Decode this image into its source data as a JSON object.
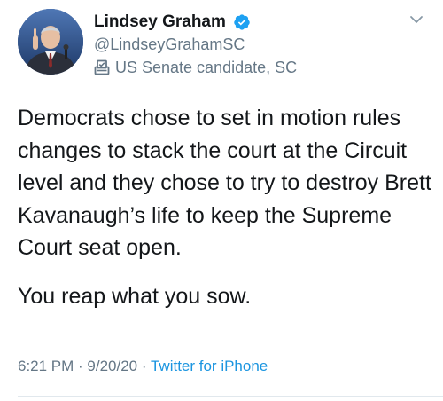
{
  "author": {
    "display_name": "Lindsey Graham",
    "handle": "@LindseyGrahamSC",
    "label": "US Senate candidate, SC",
    "verified": true
  },
  "icons": {
    "verified": "verified-badge-icon",
    "label": "ballot-box-icon",
    "menu": "chevron-down-icon"
  },
  "tweet": {
    "paragraph_1": "Democrats chose to set in motion rules changes to stack the court at the Circuit level and they chose to try to destroy Brett Kavanaugh’s life to keep the Supreme Court seat open.",
    "paragraph_2": "You reap what you sow."
  },
  "meta": {
    "time": "6:21 PM",
    "separator_1": " · ",
    "date": "9/20/20",
    "separator_2": " · ",
    "source": "Twitter for iPhone"
  },
  "colors": {
    "text": "#14171a",
    "secondary": "#657786",
    "accent": "#1b95e0",
    "verified": "#1da1f2"
  }
}
